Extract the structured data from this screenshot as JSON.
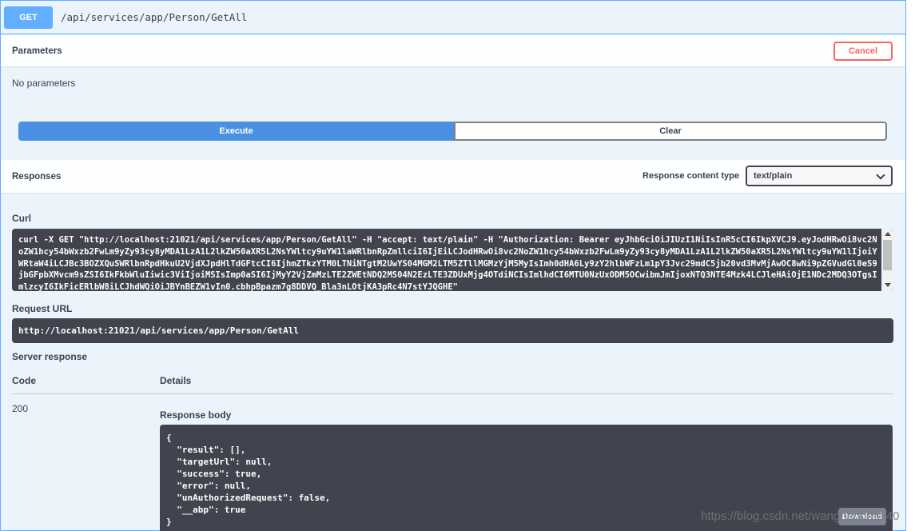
{
  "endpoint": {
    "method": "GET",
    "path": "/api/services/app/Person/GetAll"
  },
  "parameters": {
    "title": "Parameters",
    "cancel_label": "Cancel",
    "empty_text": "No parameters"
  },
  "actions": {
    "execute_label": "Execute",
    "clear_label": "Clear"
  },
  "responses": {
    "title": "Responses",
    "content_type_label": "Response content type",
    "content_type_value": "text/plain"
  },
  "curl": {
    "label": "Curl",
    "command": "curl -X GET \"http://localhost:21021/api/services/app/Person/GetAll\" -H \"accept: text/plain\" -H \"Authorization: Bearer eyJhbGciOiJIUzI1NiIsInR5cCI6IkpXVCJ9.eyJodHRwOi8vc2NoZW1hcy54bWxzb2FwLm9yZy93cy8yMDA1LzA1L2lkZW50aXR5L2NsYWltcy9uYW1laWRlbnRpZmllciI6IjEiLCJodHRwOi8vc2NoZW1hcy54bWxzb2FwLm9yZy93cy8yMDA1LzA1L2lkZW50aXR5L2NsYWltcy9uYW1lIjoiYWRtaW4iLCJBc3BOZXQuSWRlbnRpdHkuU2VjdXJpdHlTdGFtcCI6IjhmZTkzYTM0LTNiNTgtM2UwYS04MGM2LTM5ZTllMGMzYjM5MyIsImh0dHA6Ly9zY2hlbWFzLm1pY3Jvc29mdC5jb20vd3MvMjAwOC8wNi9pZGVudGl0eS9jbGFpbXMvcm9sZSI6IkFkbWluIiwic3ViIjoiMSIsImp0aSI6IjMyY2VjZmMzLTE2ZWEtNDQ2MS04N2EzLTE3ZDUxMjg4OTdiNCIsImlhdCI6MTU0NzUxODM5OCwibmJmIjoxNTQ3NTE4Mzk4LCJleHAiOjE1NDc2MDQ3OTgsImlzcyI6IkFicERlbW8iLCJhdWQiOiJBYnBEZW1vIn0.cbhpBpazm7g8DDVQ_Bla3nLOtjKA3pRc4N7stYJQGHE\""
  },
  "request_url": {
    "label": "Request URL",
    "value": "http://localhost:21021/api/services/app/Person/GetAll"
  },
  "server_response": {
    "label": "Server response",
    "code_header": "Code",
    "details_header": "Details",
    "code": "200",
    "body_label": "Response body",
    "body": "{\n  \"result\": [],\n  \"targetUrl\": null,\n  \"success\": true,\n  \"error\": null,\n  \"unAuthorizedRequest\": false,\n  \"__abp\": true\n}",
    "download_label": "Download"
  },
  "watermark": "https://blog.csdn.net/wanghengmei40",
  "colors": {
    "get_blue": "#61affe",
    "execute_blue": "#4990e2",
    "cancel_red": "#ff6060",
    "code_bg": "#41444e"
  }
}
